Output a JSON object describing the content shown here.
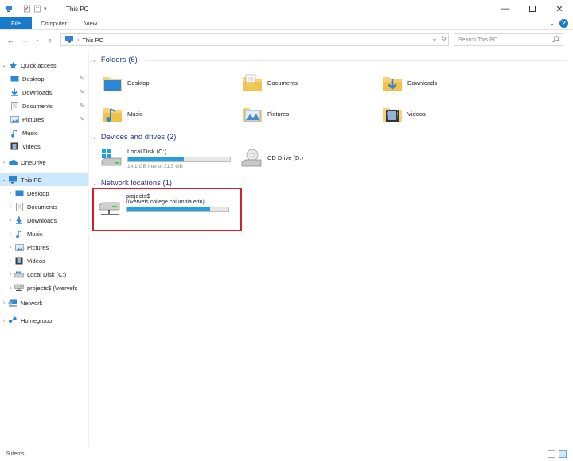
{
  "window": {
    "title": "This PC",
    "controls": [
      "minimize-icon",
      "maximize-icon",
      "close-icon"
    ]
  },
  "ribbon": {
    "tabs": [
      "File",
      "Computer",
      "View"
    ]
  },
  "address": {
    "path": "This PC",
    "search_placeholder": "Search This PC"
  },
  "nav": {
    "items": [
      {
        "label": "Quick access",
        "icon": "star-icon"
      },
      {
        "label": "Desktop",
        "icon": "desktop-icon"
      },
      {
        "label": "Downloads",
        "icon": "download-icon"
      },
      {
        "label": "Documents",
        "icon": "document-icon"
      },
      {
        "label": "Pictures",
        "icon": "picture-icon"
      },
      {
        "label": "Music",
        "icon": "music-icon"
      },
      {
        "label": "Videos",
        "icon": "video-icon"
      },
      {
        "label": "OneDrive",
        "icon": "cloud-icon"
      },
      {
        "label": "This PC",
        "icon": "computer-icon"
      },
      {
        "label": "Desktop",
        "icon": "desktop-icon"
      },
      {
        "label": "Documents",
        "icon": "document-icon"
      },
      {
        "label": "Downloads",
        "icon": "download-icon"
      },
      {
        "label": "Music",
        "icon": "music-icon"
      },
      {
        "label": "Pictures",
        "icon": "picture-icon"
      },
      {
        "label": "Videos",
        "icon": "video-icon"
      },
      {
        "label": "Local Disk (C:)",
        "icon": "disk-icon"
      },
      {
        "label": "projects$ (\\\\vervefs",
        "icon": "network-drive-icon"
      },
      {
        "label": "Network",
        "icon": "network-icon"
      },
      {
        "label": "Homegroup",
        "icon": "homegroup-icon"
      }
    ]
  },
  "sections": {
    "folders": "Folders (6)",
    "drives": "Devices and drives (2)",
    "network": "Network locations (1)"
  },
  "folders": [
    {
      "label": "Desktop",
      "icon": "desktop-folder-icon"
    },
    {
      "label": "Documents",
      "icon": "documents-folder-icon"
    },
    {
      "label": "Downloads",
      "icon": "downloads-folder-icon"
    },
    {
      "label": "Music",
      "icon": "music-folder-icon"
    },
    {
      "label": "Pictures",
      "icon": "pictures-folder-icon"
    },
    {
      "label": "Videos",
      "icon": "videos-folder-icon"
    }
  ],
  "drives": {
    "local": {
      "name": "Local Disk (C:)",
      "free": "14.1 GB free of 31.5 GB",
      "used_fraction": 0.55
    },
    "cd": {
      "name": "CD Drive (D:)"
    }
  },
  "network": {
    "name": "projects$",
    "path": "(\\\\vervefs.college.columbia.edu) ...",
    "used_fraction": 0.82
  },
  "status": {
    "items": "9 items"
  },
  "colors": {
    "accent": "#1979ca",
    "selection": "#cce8ff",
    "bar_fill": "#26a0da",
    "highlight": "#d81e2a",
    "section_header": "#1e3287"
  }
}
